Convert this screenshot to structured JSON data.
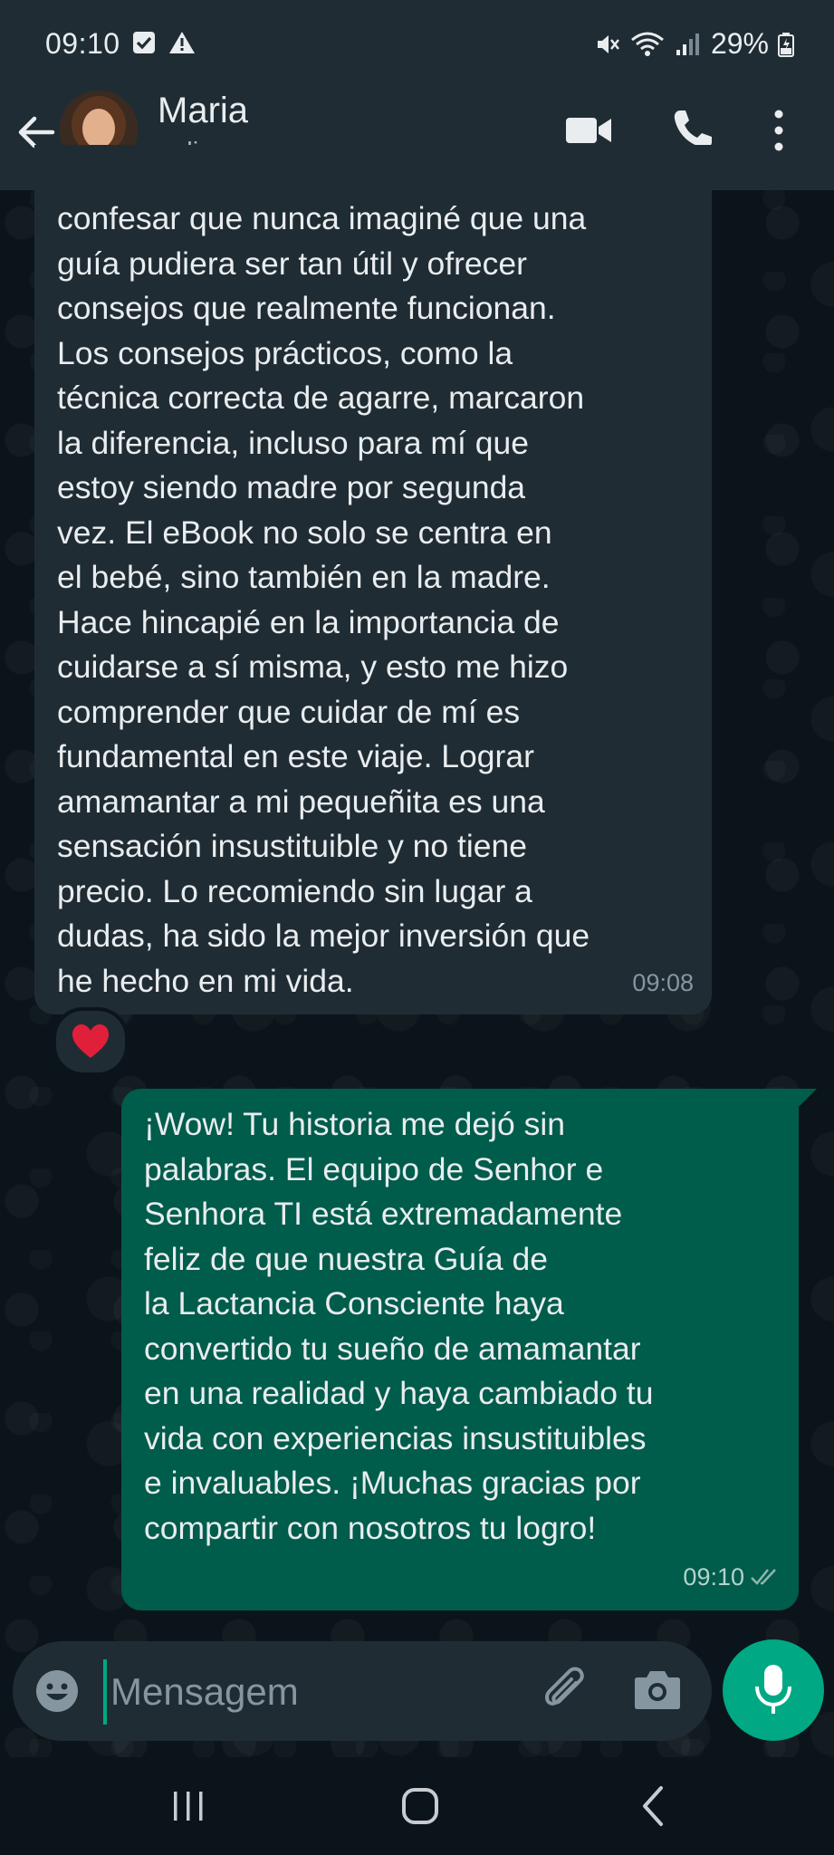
{
  "status_bar": {
    "time": "09:10",
    "battery": "29%",
    "icons": [
      "notification-check-icon",
      "warning-icon",
      "mute-icon",
      "wifi-icon",
      "signal-icon",
      "battery-charging-icon"
    ]
  },
  "header": {
    "contact_name": "Maria",
    "contact_status": "online",
    "icons": [
      "back-arrow-icon",
      "video-call-icon",
      "phone-icon",
      "more-vert-icon"
    ]
  },
  "messages": [
    {
      "direction": "incoming",
      "text": "confesar que nunca imaginé que una\nguía pudiera ser tan útil y ofrecer\nconsejos que realmente funcionan.\nLos consejos prácticos, como la\ntécnica correcta de agarre, marcaron\nla diferencia, incluso para mí que\nestoy siendo madre por segunda\nvez. El eBook no solo se centra en\nel bebé, sino también en la madre.\nHace hincapié en la importancia de\ncuidarse a sí misma, y esto me hizo\ncomprender que cuidar de mí es\nfundamental en este viaje. Lograr\namamantar a mi pequeñita es una\nsensación insustituible y no tiene\nprecio. Lo recomiendo sin lugar a\ndudas, ha sido la mejor inversión que\nhe hecho en mi vida.",
      "time": "09:08",
      "reaction": "❤️"
    },
    {
      "direction": "outgoing",
      "text": "¡Wow! Tu historia me dejó sin\npalabras. El equipo de Senhor e\nSenhora TI está extremadamente\nfeliz de que nuestra Guía de\nla Lactancia Consciente haya\nconvertido tu sueño de amamantar\nen una realidad y haya cambiado tu\nvida con experiencias insustituibles\ne invaluables. ¡Muchas gracias por\ncompartir con nosotros tu logro!",
      "time": "09:10",
      "status": "read"
    }
  ],
  "composer": {
    "placeholder": "Mensagem"
  },
  "colors": {
    "background": "#0b141a",
    "header": "#1f2c33",
    "incoming_bubble": "#202c33",
    "outgoing_bubble": "#005c4b",
    "accent": "#00a884",
    "read_ticks": "#8fb6ad"
  }
}
